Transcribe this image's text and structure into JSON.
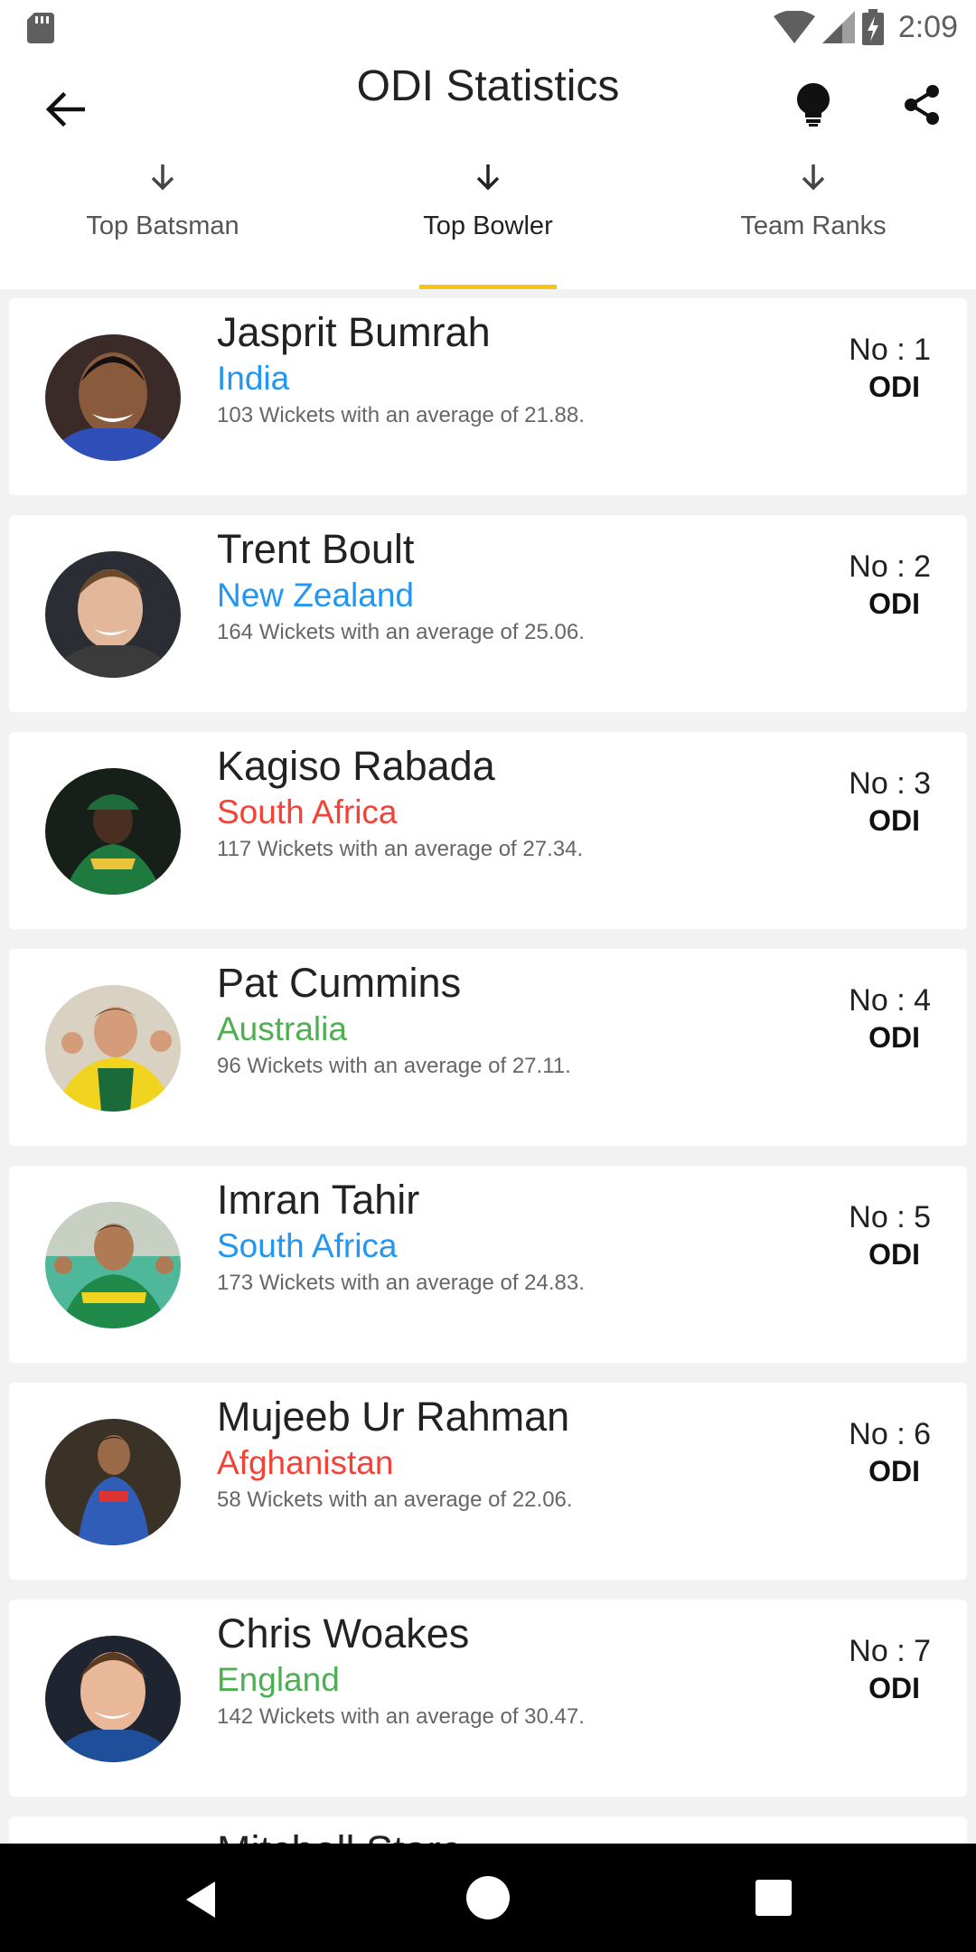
{
  "status_bar": {
    "time": "2:09"
  },
  "app_bar": {
    "title": "ODI Statistics"
  },
  "tabs": [
    {
      "label": "Top Batsman",
      "active": false
    },
    {
      "label": "Top Bowler",
      "active": true
    },
    {
      "label": "Team Ranks",
      "active": false
    }
  ],
  "players": [
    {
      "name": "Jasprit Bumrah",
      "country": "India",
      "country_color": "#2196f3",
      "stats": "103 Wickets with an average of 21.88.",
      "rank": "No : 1",
      "format": "ODI"
    },
    {
      "name": "Trent Boult",
      "country": "New Zealand",
      "country_color": "#2196f3",
      "stats": "164 Wickets with an average of 25.06.",
      "rank": "No : 2",
      "format": "ODI"
    },
    {
      "name": "Kagiso Rabada",
      "country": "South Africa",
      "country_color": "#f44336",
      "stats": "117 Wickets with an average of 27.34.",
      "rank": "No : 3",
      "format": "ODI"
    },
    {
      "name": "Pat Cummins",
      "country": "Australia",
      "country_color": "#4caf50",
      "stats": "96 Wickets with an average of 27.11.",
      "rank": "No : 4",
      "format": "ODI"
    },
    {
      "name": "Imran Tahir",
      "country": "South Africa",
      "country_color": "#2196f3",
      "stats": "173 Wickets with an average of 24.83.",
      "rank": "No : 5",
      "format": "ODI"
    },
    {
      "name": "Mujeeb Ur Rahman",
      "country": "Afghanistan",
      "country_color": "#f44336",
      "stats": "58 Wickets with an average of 22.06.",
      "rank": "No : 6",
      "format": "ODI"
    },
    {
      "name": "Chris Woakes",
      "country": "England",
      "country_color": "#4caf50",
      "stats": "142 Wickets with an average of 30.47.",
      "rank": "No : 7",
      "format": "ODI"
    }
  ],
  "partial_player": {
    "name": "Mitchell Starc"
  },
  "colors": {
    "accent": "#f5c518",
    "blue": "#2196f3",
    "red": "#f44336",
    "green": "#4caf50"
  },
  "icons": {
    "status": [
      "sd-card-icon",
      "wifi-icon",
      "signal-icon",
      "battery-charging-icon"
    ],
    "app_bar": [
      "back-arrow-icon",
      "lightbulb-icon",
      "share-icon"
    ],
    "tabs": "arrow-down-icon",
    "nav": [
      "nav-back-icon",
      "nav-home-icon",
      "nav-recents-icon"
    ]
  }
}
